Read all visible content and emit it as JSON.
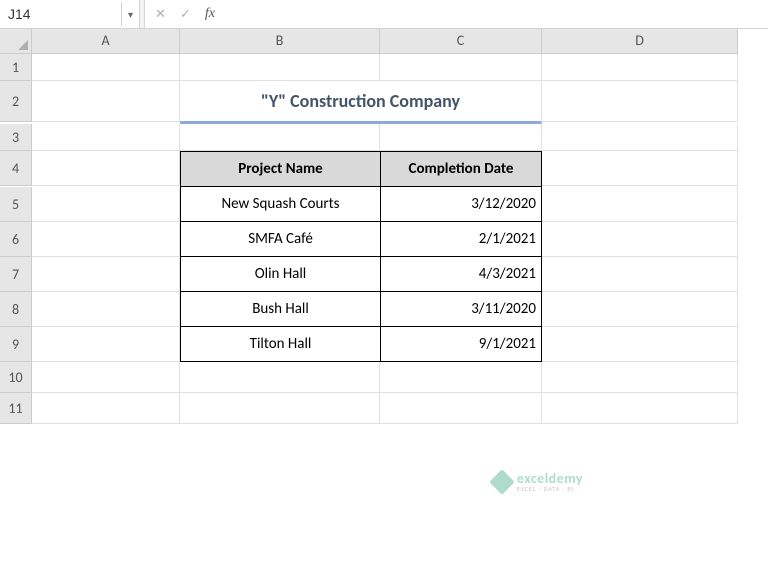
{
  "formula_bar": {
    "name_box": "J14",
    "cancel": "✕",
    "enter": "✓",
    "fx": "fx",
    "formula": ""
  },
  "columns": [
    "A",
    "B",
    "C",
    "D"
  ],
  "rows": [
    "1",
    "2",
    "3",
    "4",
    "5",
    "6",
    "7",
    "8",
    "9",
    "10",
    "11"
  ],
  "title": "\"Y\" Construction Company",
  "table": {
    "headers": {
      "project": "Project Name",
      "completion": "Completion Date"
    },
    "rows": [
      {
        "project": "New Squash Courts",
        "completion": "3/12/2020"
      },
      {
        "project": "SMFA Café",
        "completion": "2/1/2021"
      },
      {
        "project": "Olin Hall",
        "completion": "4/3/2021"
      },
      {
        "project": "Bush Hall",
        "completion": "3/11/2020"
      },
      {
        "project": "Tilton Hall",
        "completion": "9/1/2021"
      }
    ]
  },
  "watermark": {
    "main": "exceldemy",
    "sub": "EXCEL · DATA · BI"
  }
}
